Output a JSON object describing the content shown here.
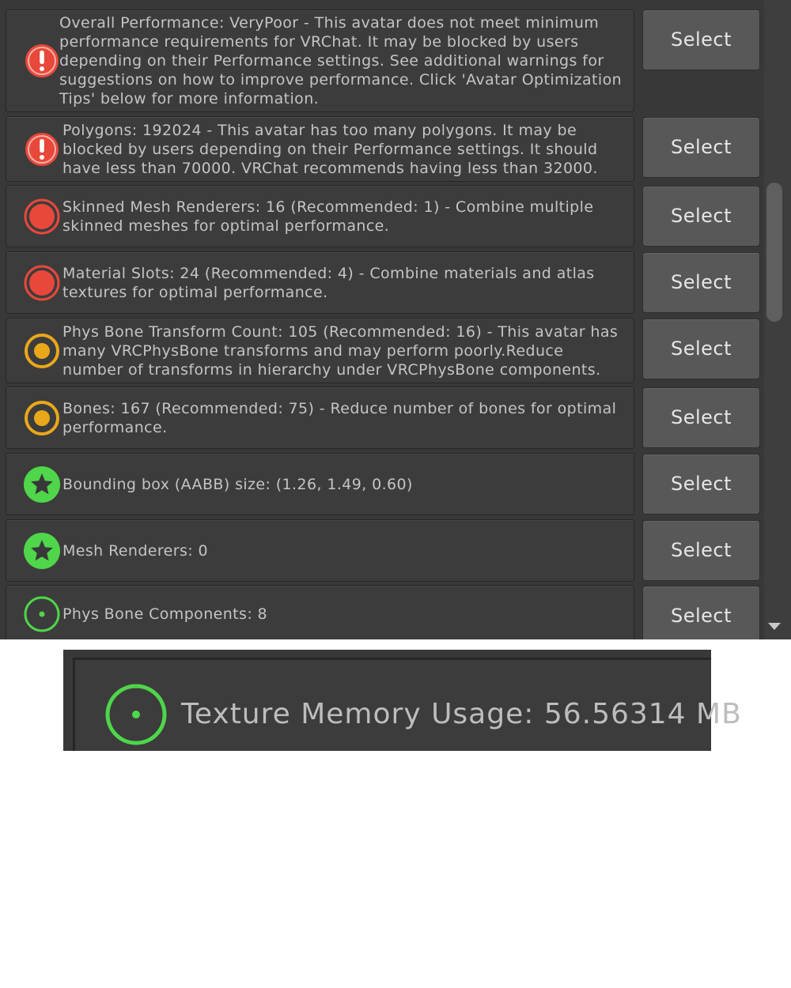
{
  "items": [
    {
      "severity": "error",
      "icon": "exclamation-circle-icon",
      "text": "Overall Performance: VeryPoor - This avatar does not meet minimum performance requirements for VRChat. It may be blocked by users depending on their Performance settings. See additional warnings for suggestions on how to improve performance. Click 'Avatar Optimization Tips' below for more information.",
      "button": "Select"
    },
    {
      "severity": "error",
      "icon": "exclamation-circle-icon",
      "text": "Polygons: 192024 - This avatar has too many polygons. It may be blocked by users depending on their Performance settings. It should have less than 70000. VRChat recommends having less than 32000.",
      "button": "Select"
    },
    {
      "severity": "poor",
      "icon": "red-circle-icon",
      "text": "Skinned Mesh Renderers: 16 (Recommended: 1) - Combine multiple skinned meshes for optimal performance.",
      "button": "Select"
    },
    {
      "severity": "poor",
      "icon": "red-circle-icon",
      "text": "Material Slots: 24 (Recommended: 4) - Combine materials and atlas textures for optimal performance.",
      "button": "Select"
    },
    {
      "severity": "medium",
      "icon": "yellow-circle-icon",
      "text": "Phys Bone Transform Count: 105 (Recommended: 16) - This avatar has many VRCPhysBone transforms and may perform poorly.Reduce number of transforms in hierarchy under VRCPhysBone components.",
      "button": "Select"
    },
    {
      "severity": "medium",
      "icon": "yellow-circle-icon",
      "text": "Bones: 167 (Recommended: 75) - Reduce number of bones for optimal performance.",
      "button": "Select"
    },
    {
      "severity": "excellent",
      "icon": "green-star-icon",
      "text": "Bounding box (AABB) size: (1.26, 1.49, 0.60)",
      "button": "Select"
    },
    {
      "severity": "excellent",
      "icon": "green-star-icon",
      "text": "Mesh Renderers: 0",
      "button": "Select"
    },
    {
      "severity": "good",
      "icon": "green-ring-icon",
      "text": "Phys Bone Components: 8",
      "button": "Select"
    }
  ],
  "zoom": {
    "icon": "green-ring-icon",
    "text": "Texture Memory Usage: 56.56314 MB"
  },
  "colors": {
    "error": "#e8483a",
    "poor": "#e8483a",
    "medium": "#e9a81a",
    "excellent": "#4fd64a",
    "good": "#4fd64a"
  }
}
